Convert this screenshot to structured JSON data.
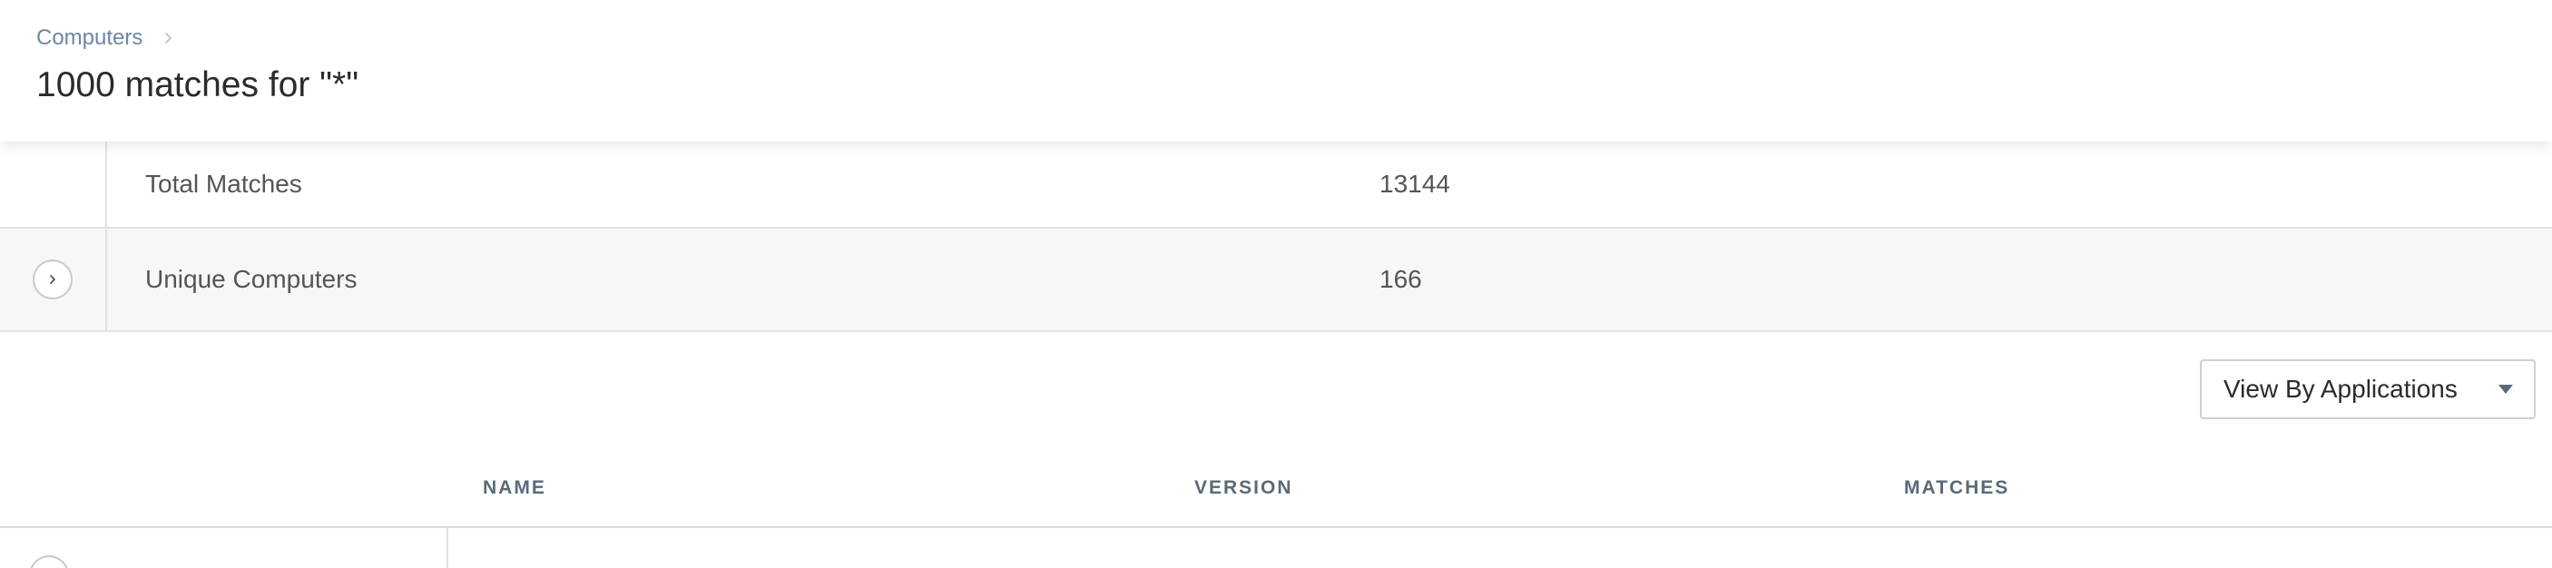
{
  "breadcrumb": {
    "items": [
      "Computers"
    ]
  },
  "page": {
    "title": "1000 matches for \"*\""
  },
  "summary": {
    "rows": [
      {
        "label": "Total Matches",
        "value": "13144"
      },
      {
        "label": "Unique Computers",
        "value": "166"
      }
    ]
  },
  "controls": {
    "view_select": {
      "selected": "View By Applications"
    }
  },
  "table": {
    "columns": [
      "NAME",
      "VERSION",
      "MATCHES"
    ]
  },
  "colors": {
    "breadcrumb_link": "#6b87a6",
    "title": "#2b2b2b",
    "header_text": "#5a6a7a",
    "row_alt_bg": "#f7f7f7",
    "border": "#e3e3e3"
  },
  "icons": [
    "chevron-right-icon",
    "chevron-down-icon",
    "caret-down-icon"
  ]
}
